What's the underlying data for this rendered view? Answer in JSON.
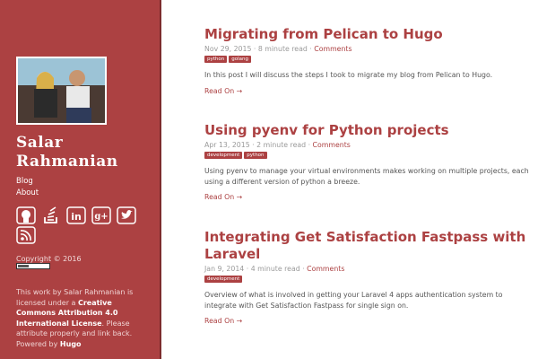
{
  "sidebar": {
    "site_title": "Salar Rahmanian",
    "nav": [
      {
        "label": "Blog"
      },
      {
        "label": "About"
      }
    ],
    "social_icons": [
      "github-icon",
      "stackoverflow-icon",
      "linkedin-icon",
      "googleplus-icon",
      "twitter-icon",
      "rss-icon"
    ],
    "copyright": "Copyright © 2016",
    "license": {
      "prefix": "This work by Salar Rahmanian is licensed under a ",
      "link": "Creative Commons Attribution 4.0 International License",
      "suffix": ". Please attribute properly and link back. Powered by ",
      "powered": "Hugo"
    }
  },
  "posts": [
    {
      "title": "Migrating from Pelican to Hugo",
      "date": "Nov 29, 2015",
      "read_time": "8 minute read",
      "comments": "Comments",
      "tags": [
        "python",
        "golang"
      ],
      "excerpt": "In this post I will discuss the steps I took to migrate my blog from Pelican to Hugo.",
      "read_on": "Read On →"
    },
    {
      "title": "Using pyenv for Python projects",
      "date": "Apr 13, 2015",
      "read_time": "2 minute read",
      "comments": "Comments",
      "tags": [
        "development",
        "python"
      ],
      "excerpt": "Using pyenv to manage your virtual environments makes working on multiple projects, each using a different version of python a breeze.",
      "read_on": "Read On →"
    },
    {
      "title": "Integrating Get Satisfaction Fastpass with Laravel",
      "date": "Jan 9, 2014",
      "read_time": "4 minute read",
      "comments": "Comments",
      "tags": [
        "development"
      ],
      "excerpt": "Overview of what is involved in getting your Laravel 4 apps authentication system to integrate with Get Satisfaction Fastpass for single sign on.",
      "read_on": "Read On →"
    }
  ],
  "colors": {
    "accent": "#ac4142",
    "text": "#555555",
    "meta": "#9a9a9a"
  }
}
